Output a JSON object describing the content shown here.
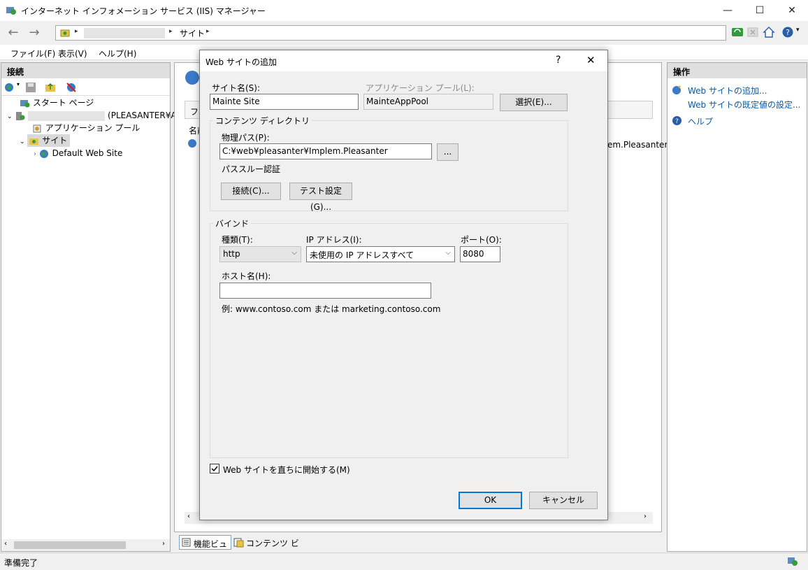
{
  "window": {
    "title": "インターネット インフォメーション サービス (IIS) マネージャー",
    "minimize": "—",
    "maximize": "☐",
    "close": "✕"
  },
  "address": {
    "site_segment": "サイト",
    "arrow": "▸"
  },
  "menu": {
    "file": "ファイル(F)",
    "view": "表示(V)",
    "help": "ヘルプ(H)"
  },
  "connections": {
    "header": "接続",
    "start_page": "スタート ページ",
    "server_suffix": "(PLEASANTER¥A",
    "app_pools": "アプリケーション プール",
    "sites": "サイト",
    "default_site": "Default Web Site"
  },
  "center": {
    "partial_tab": "フィ",
    "partial_col": "名前",
    "partial_path": "plem.Pleasanter",
    "feature_view": "機能ビュー",
    "content_view": "コンテンツ ビュー"
  },
  "actions": {
    "header": "操作",
    "add_site": "Web サイトの追加...",
    "site_defaults": "Web サイトの既定値の設定...",
    "help": "ヘルプ"
  },
  "status": {
    "text": "準備完了"
  },
  "dialog": {
    "title": "Web サイトの追加",
    "help_glyph": "?",
    "close_glyph": "✕",
    "site_name_label": "サイト名(S):",
    "site_name_value": "Mainte Site",
    "app_pool_label": "アプリケーション プール(L):",
    "app_pool_value": "MainteAppPool",
    "select_button": "選択(E)...",
    "content_dir_legend": "コンテンツ ディレクトリ",
    "physical_path_label": "物理パス(P):",
    "physical_path_value": "C:¥web¥pleasanter¥Implem.Pleasanter",
    "browse_button": "...",
    "passthrough_label": "パススルー認証",
    "connect_as_button": "接続(C)...",
    "test_settings_button": "テスト設定(G)...",
    "binding_legend": "バインド",
    "type_label": "種類(T):",
    "type_value": "http",
    "ip_label": "IP アドレス(I):",
    "ip_value": "未使用の IP アドレスすべて",
    "port_label": "ポート(O):",
    "port_value": "8080",
    "host_label": "ホスト名(H):",
    "host_value": "",
    "example_text": "例: www.contoso.com または marketing.contoso.com",
    "start_checkbox_label": "Web サイトを直ちに開始する(M)",
    "ok_button": "OK",
    "cancel_button": "キャンセル"
  },
  "colors": {
    "link": "#0a5aa8",
    "focus": "#0078d7",
    "panel_header": "#dfdfdf"
  }
}
